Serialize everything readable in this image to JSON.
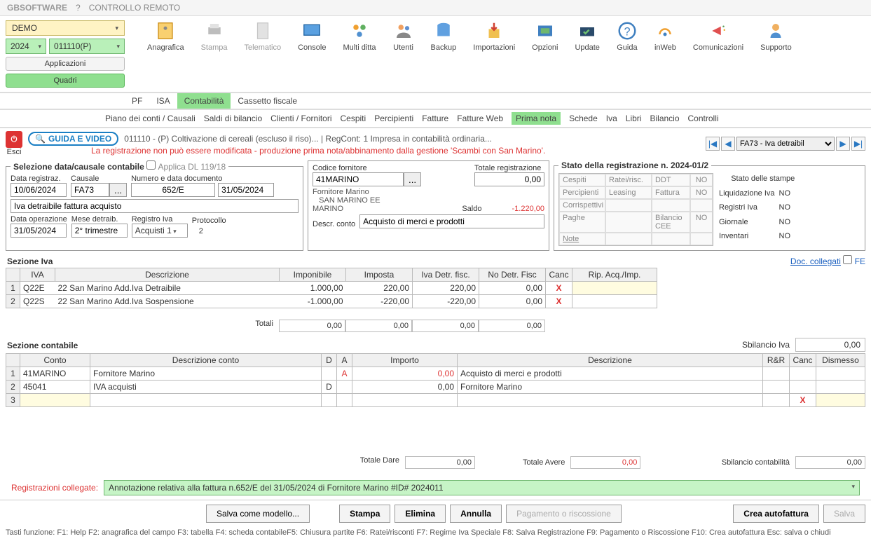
{
  "topbar": {
    "brand": "GBSOFTWARE",
    "q": "?",
    "remote": "CONTROLLO REMOTO"
  },
  "ribbon": {
    "demo": "DEMO",
    "year": "2024",
    "code": "011110(P)",
    "tools": [
      "Anagrafica",
      "Stampa",
      "Telematico",
      "Console",
      "Multi ditta",
      "Utenti",
      "Backup",
      "Importazioni",
      "Opzioni",
      "Update",
      "Guida",
      "inWeb",
      "Comunicazioni",
      "Supporto"
    ],
    "apps": "Applicazioni",
    "quadri": "Quadri"
  },
  "tabs1": {
    "pf": "PF",
    "isa": "ISA",
    "cont": "Contabilità",
    "cass": "Cassetto fiscale"
  },
  "tabs2": [
    "Piano dei conti / Causali",
    "Saldi di bilancio",
    "Clienti / Fornitori",
    "Cespiti",
    "Percipienti",
    "Fatture",
    "Fatture Web",
    "Prima nota",
    "Schede",
    "Iva",
    "Libri",
    "Bilancio",
    "Controlli"
  ],
  "head": {
    "esci": "Esci",
    "guida": "GUIDA E VIDEO",
    "info": "011110 - (P) Coltivazione di cereali (escluso il riso)... | RegCont: 1 Impresa  in contabilità ordinaria...",
    "warn": "La registrazione non può essere modificata - produzione prima nota/abbinamento dalla gestione 'Scambi con San Marino'.",
    "pager": "FA73 - Iva detraibil"
  },
  "sel": {
    "legend": "Selezione data/causale contabile",
    "dl": "Applica DL 119/18",
    "dataReg": "Data registraz.",
    "dataRegV": "10/06/2024",
    "causale": "Causale",
    "causaleV": "FA73",
    "numdoc": "Numero e data documento",
    "numdocV": "652/E",
    "dataDocV": "31/05/2024",
    "desc": "Iva detraibile fattura acquisto",
    "dataOp": "Data operazione",
    "dataOpV": "31/05/2024",
    "meseDet": "Mese detraib.",
    "meseDetV": "2° trimestre",
    "regIva": "Registro Iva",
    "regIvaV": "Acquisti  1",
    "prot": "Protocollo",
    "protV": "2"
  },
  "forn": {
    "codLbl": "Codice fornitore",
    "codV": "41MARINO",
    "nome": "Fornitore Marino",
    "riga2": "   SAN MARINO EE",
    "riga3": "MARINO",
    "saldoLbl": "Saldo",
    "saldoV": "-1.220,00",
    "descConto": "Descr. conto",
    "descContoV": "Acquisto di merci e prodotti",
    "totReg": "Totale registrazione",
    "totRegV": "0,00"
  },
  "stato": {
    "legend": "Stato della registrazione n. 2024-01/2",
    "grid": [
      [
        "Cespiti",
        "Ratei/risc.",
        "DDT",
        "NO"
      ],
      [
        "Percipienti",
        "Leasing",
        "Fattura",
        "NO"
      ],
      [
        "Corrispettivi",
        "",
        "",
        ""
      ],
      [
        "Paghe",
        "",
        "Bilancio CEE",
        "NO"
      ],
      [
        "Note",
        "",
        "",
        ""
      ]
    ],
    "stampeH": "Stato delle stampe",
    "stampe": [
      [
        "Liquidazione Iva",
        "NO"
      ],
      [
        "Registri Iva",
        "NO"
      ],
      [
        "Giornale",
        "NO"
      ],
      [
        "Inventari",
        "NO"
      ]
    ],
    "docColl": "Doc. collegati",
    "fe": "FE"
  },
  "iva": {
    "lbl": "Sezione Iva",
    "cols": [
      "IVA",
      "Descrizione",
      "Imponibile",
      "Imposta",
      "Iva Detr. fisc.",
      "No Detr. Fisc",
      "Canc",
      "Rip. Acq./Imp."
    ],
    "rows": [
      {
        "n": "1",
        "iva": "Q22E",
        "desc": "22 San Marino Add.Iva Detraibile",
        "imp": "1.000,00",
        "imposta": "220,00",
        "detr": "220,00",
        "nodetr": "0,00"
      },
      {
        "n": "2",
        "iva": "Q22S",
        "desc": "22 San Marino Add.Iva Sospensione",
        "imp": "-1.000,00",
        "imposta": "-220,00",
        "detr": "-220,00",
        "nodetr": "0,00"
      }
    ],
    "totLbl": "Totali",
    "tots": [
      "0,00",
      "0,00",
      "0,00",
      "0,00"
    ],
    "sbilLbl": "Sbilancio Iva",
    "sbilV": "0,00"
  },
  "cont": {
    "lbl": "Sezione contabile",
    "cols": [
      "Conto",
      "Descrizione conto",
      "D",
      "A",
      "Importo",
      "Descrizione",
      "R&R",
      "Canc",
      "Dismesso"
    ],
    "rows": [
      {
        "n": "1",
        "c": "41MARINO",
        "dc": "Fornitore Marino",
        "d": "",
        "a": "A",
        "imp": "0,00",
        "desc": "Acquisto di merci e prodotti",
        "impRed": true
      },
      {
        "n": "2",
        "c": "45041",
        "dc": "IVA acquisti",
        "d": "D",
        "a": "",
        "imp": "0,00",
        "desc": "Fornitore Marino"
      },
      {
        "n": "3",
        "c": "",
        "dc": "",
        "d": "",
        "a": "",
        "imp": "",
        "desc": "",
        "cancel": true
      }
    ],
    "dareLbl": "Totale Dare",
    "dareV": "0,00",
    "avereLbl": "Totale Avere",
    "avereV": "0,00",
    "sbilLbl": "Sbilancio contabilità",
    "sbilV": "0,00"
  },
  "regColl": {
    "lbl": "Registrazioni collegate:",
    "v": "Annotazione relativa alla fattura n.652/E del 31/05/2024 di Fornitore Marino #ID# 2024011"
  },
  "buttons": {
    "salvaModel": "Salva come modello...",
    "stampa": "Stampa",
    "elimina": "Elimina",
    "annulla": "Annulla",
    "pagamento": "Pagamento o riscossione",
    "creaAuto": "Crea autofattura",
    "salva": "Salva"
  },
  "fkeys": "Tasti funzione:  F1: Help  F2: anagrafica del campo  F3: tabella  F4: scheda contabileF5: Chiusura partite  F6: Ratei/risconti  F7: Regime Iva Speciale F8: Salva Registrazione  F9: Pagamento o Riscossione F10: Crea autofattura  Esc: salva o chiudi"
}
